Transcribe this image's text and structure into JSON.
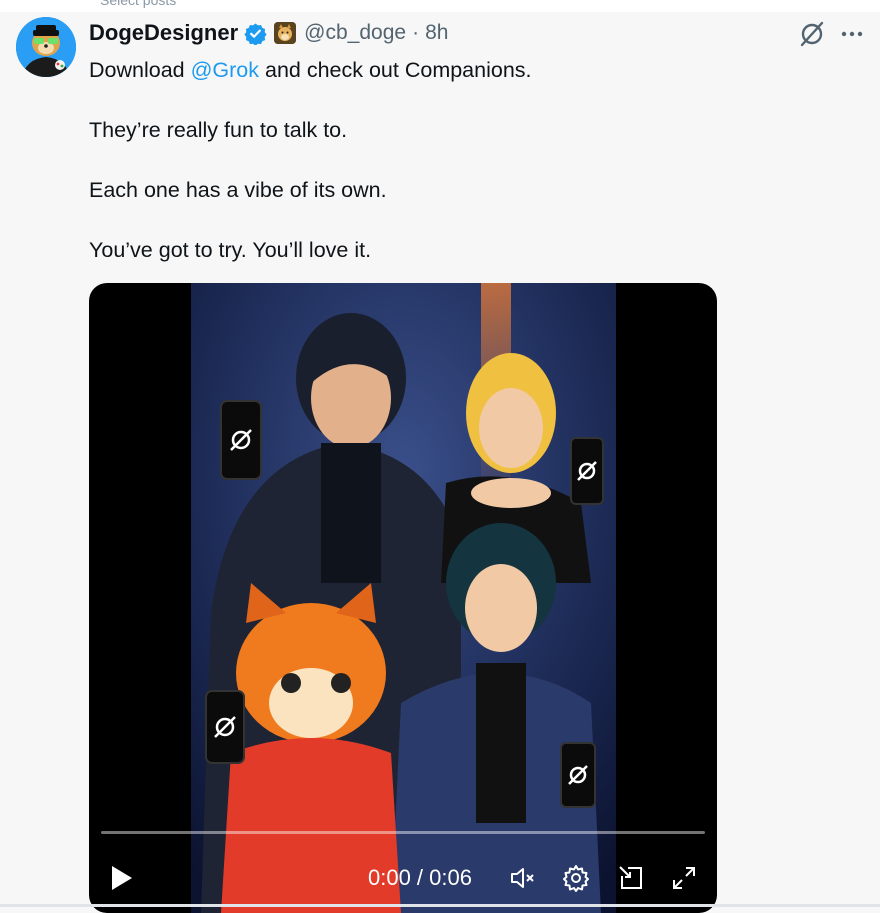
{
  "top": {
    "partial_text": "Select posts"
  },
  "tweet": {
    "author_name": "DogeDesigner",
    "handle": "@cb_doge",
    "separator": "·",
    "time": "8h",
    "text_prefix": "Download ",
    "mention": "@Grok",
    "text_suffix": " and check out Companions.",
    "paragraphs": [
      "They’re really fun to talk to.",
      "Each one has a vibe of its own.",
      "You’ve got to try. You’ll love it."
    ]
  },
  "video": {
    "time_display": "0:00 / 0:06",
    "progress": 0
  },
  "icons": {
    "verified": "verified-badge-icon",
    "grok": "grok-icon",
    "more": "more-icon",
    "play": "play-icon",
    "mute": "volume-muted-icon",
    "settings": "gear-icon",
    "pip": "picture-in-picture-icon",
    "fullscreen": "fullscreen-icon"
  },
  "colors": {
    "accent": "#1d9bf0",
    "text": "#0f1419",
    "muted": "#536471",
    "background": "#f7f7f7"
  }
}
